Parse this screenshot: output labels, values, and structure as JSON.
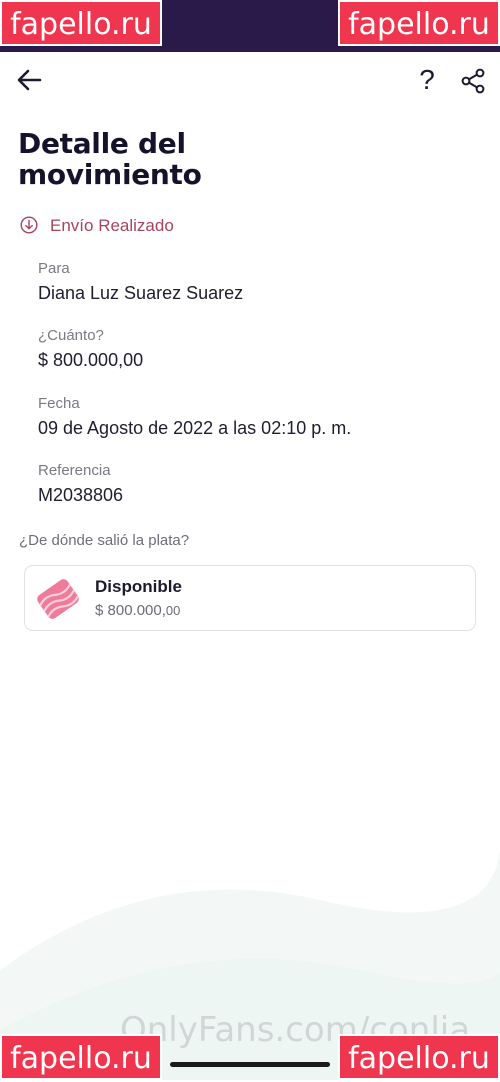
{
  "header": {
    "title": "Detalle del movimiento",
    "help_label": "?"
  },
  "status": {
    "label": "Envío Realizado",
    "color": "#a8435e"
  },
  "details": {
    "recipient_label": "Para",
    "recipient_value": "Diana Luz Suarez Suarez",
    "amount_label": "¿Cuánto?",
    "amount_value": "$ 800.000,00",
    "date_label": "Fecha",
    "date_value": "09 de Agosto de 2022 a las 02:10 p. m.",
    "reference_label": "Referencia",
    "reference_value": "M2038806"
  },
  "source": {
    "question": "¿De dónde salió la plata?",
    "account_name": "Disponible",
    "account_amount_main": "$ 800.000,",
    "account_amount_cents": "00"
  },
  "overlays": {
    "watermark_site": "fapello.ru",
    "watermark_platform": "OnlyFans.com/conlia"
  },
  "colors": {
    "status_bar": "#2a1a4a",
    "title": "#15122b",
    "watermark_bg": "#f0354f",
    "wallet_pink": "#e8577e"
  }
}
